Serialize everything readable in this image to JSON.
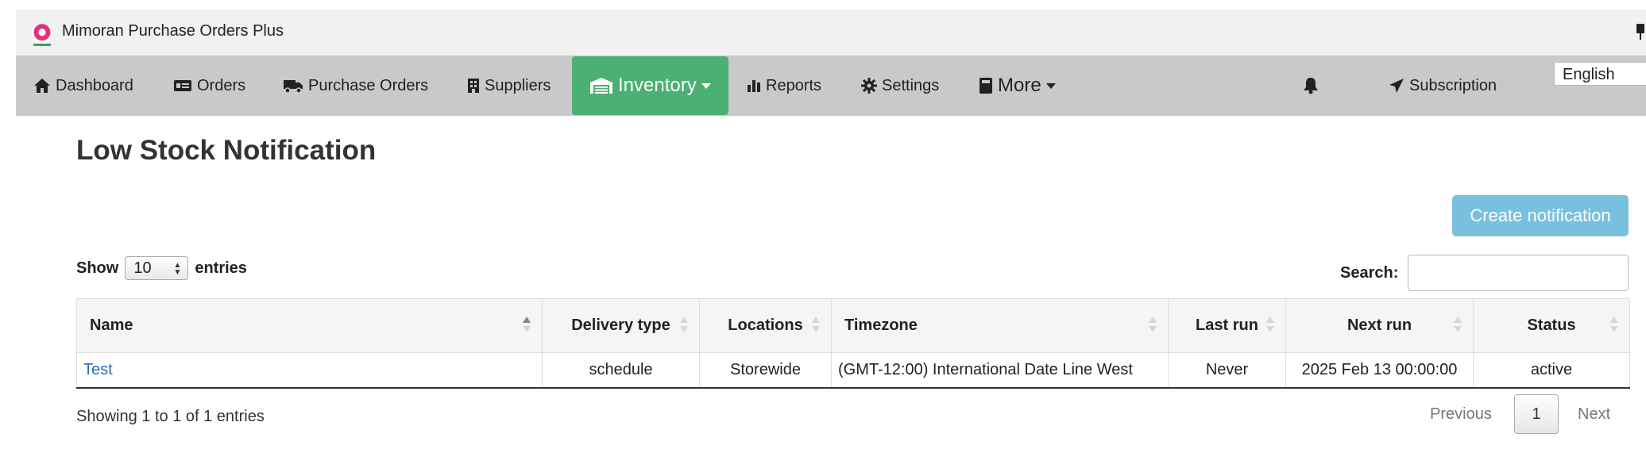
{
  "app": {
    "title": "Mimoran Purchase Orders Plus"
  },
  "nav": {
    "items": [
      {
        "label": "Dashboard",
        "icon": "home-icon"
      },
      {
        "label": "Orders",
        "icon": "money-bill-icon"
      },
      {
        "label": "Purchase Orders",
        "icon": "truck-icon"
      },
      {
        "label": "Suppliers",
        "icon": "building-icon"
      },
      {
        "label": "Inventory",
        "icon": "warehouse-icon",
        "active": true
      },
      {
        "label": "Reports",
        "icon": "bar-chart-icon"
      },
      {
        "label": "Settings",
        "icon": "gear-icon"
      },
      {
        "label": "More",
        "icon": "book-icon"
      },
      {
        "label": "Subscription",
        "icon": "paper-plane-icon"
      }
    ],
    "bell_icon": "bell-icon",
    "language": "English",
    "accent_color": "#4caf73"
  },
  "page": {
    "title": "Low Stock Notification",
    "create_button": "Create notification"
  },
  "table_controls": {
    "show_label": "Show",
    "entries_value": "10",
    "entries_label": "entries",
    "search_label": "Search:",
    "search_value": ""
  },
  "table": {
    "columns": [
      "Name",
      "Delivery type",
      "Locations",
      "Timezone",
      "Last run",
      "Next run",
      "Status"
    ],
    "rows": [
      [
        "Test",
        "schedule",
        "Storewide",
        "(GMT-12:00) International Date Line West",
        "Never",
        "2025 Feb 13 00:00:00",
        "active"
      ]
    ]
  },
  "footer": {
    "info": "Showing 1 to 1 of 1 entries",
    "previous": "Previous",
    "page": "1",
    "next": "Next"
  }
}
